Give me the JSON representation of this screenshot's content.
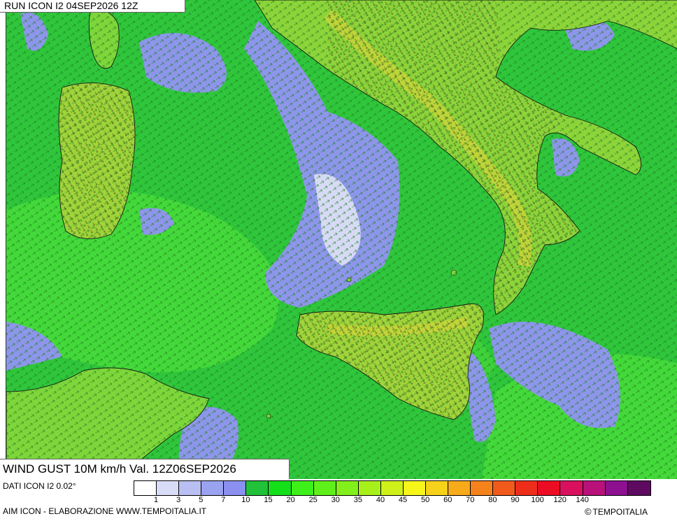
{
  "header": {
    "run_label": "RUN ICON I2 04SEP2026 12Z",
    "title": "WIND GUST 10M km/h Val. 12Z06SEP2026"
  },
  "footer": {
    "data_source": "DATI ICON I2 0.02°",
    "credit": "AIM ICON - ELABORAZIONE WWW.TEMPOITALIA.IT",
    "copyright_symbol": "©",
    "copyright_name": "TEMPOITALIA"
  },
  "legend": {
    "colors": [
      "#ffffff",
      "#d9dcf7",
      "#b9bff2",
      "#9aa3ef",
      "#8a8ff0",
      "#21c23a",
      "#14e01a",
      "#3ef01a",
      "#5ff01a",
      "#82f01a",
      "#a7f01a",
      "#d0f01a",
      "#f6f61a",
      "#f7d21a",
      "#f7aa1a",
      "#f5821a",
      "#f15a1a",
      "#ee2e1a",
      "#ec0c24",
      "#d8105e",
      "#b8127a",
      "#8c1090",
      "#5e0a60"
    ],
    "ticks": [
      "1",
      "3",
      "5",
      "7",
      "10",
      "15",
      "20",
      "25",
      "30",
      "35",
      "40",
      "45",
      "50",
      "60",
      "70",
      "80",
      "90",
      "100",
      "120",
      "140"
    ]
  },
  "map": {
    "sea_color": "#2fc63c",
    "land_color": "#5fd630",
    "calm_color": "#8d96ea",
    "gust_color": "#c9d43a"
  }
}
